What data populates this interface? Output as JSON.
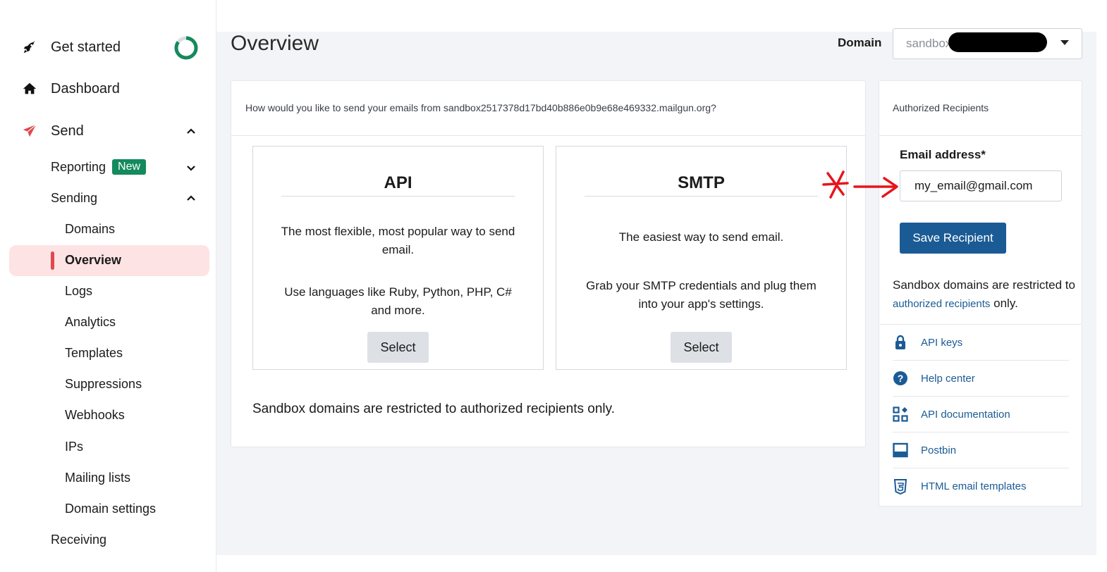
{
  "sidebar": {
    "top_items": [
      {
        "label": "Get started",
        "icon": "rocket-icon"
      },
      {
        "label": "Dashboard",
        "icon": "home-icon"
      },
      {
        "label": "Send",
        "icon": "paper-plane-icon"
      }
    ],
    "setup_progress": 0.85,
    "reporting": {
      "label": "Reporting",
      "badge": "New"
    },
    "sending": {
      "label": "Sending"
    },
    "sending_items": [
      {
        "label": "Domains"
      },
      {
        "label": "Overview",
        "active": true
      },
      {
        "label": "Logs"
      },
      {
        "label": "Analytics"
      },
      {
        "label": "Templates"
      },
      {
        "label": "Suppressions"
      },
      {
        "label": "Webhooks"
      },
      {
        "label": "IPs"
      },
      {
        "label": "Mailing lists"
      },
      {
        "label": "Domain settings"
      }
    ],
    "receiving": {
      "label": "Receiving"
    }
  },
  "header": {
    "title": "Overview",
    "domain_label": "Domain",
    "domain_value": "sandbox"
  },
  "main": {
    "question": "How would you like to send your emails from sandbox2517378d17bd40b886e0b9e68e469332.mailgun.org?",
    "options": [
      {
        "title": "API",
        "text1": "The most flexible, most popular way to send email.",
        "text2": "Use languages like Ruby, Python, PHP, C# and more.",
        "button": "Select"
      },
      {
        "title": "SMTP",
        "text1": "The easiest way to send email.",
        "text2": "Grab your SMTP credentials and plug them into your app's settings.",
        "button": "Select"
      }
    ],
    "footer_note": "Sandbox domains are restricted to authorized recipients only."
  },
  "recipients": {
    "title": "Authorized Recipients",
    "email_label": "Email address*",
    "email_value": "my_email@gmail.com",
    "save_button": "Save Recipient",
    "note_prefix": "Sandbox domains are restricted to ",
    "note_link": "authorized recipients",
    "note_suffix": " only."
  },
  "links": [
    {
      "label": "API keys",
      "icon": "lock-icon"
    },
    {
      "label": "Help center",
      "icon": "help-icon"
    },
    {
      "label": "API documentation",
      "icon": "grid-icon"
    },
    {
      "label": "Postbin",
      "icon": "inbox-icon"
    },
    {
      "label": "HTML email templates",
      "icon": "html5-icon"
    }
  ],
  "colors": {
    "brand_blue": "#1b5b95",
    "accent_red": "#e0484f",
    "badge_green": "#148a5d",
    "active_bg": "#fde3e3",
    "annotation_red": "#e8141c"
  }
}
